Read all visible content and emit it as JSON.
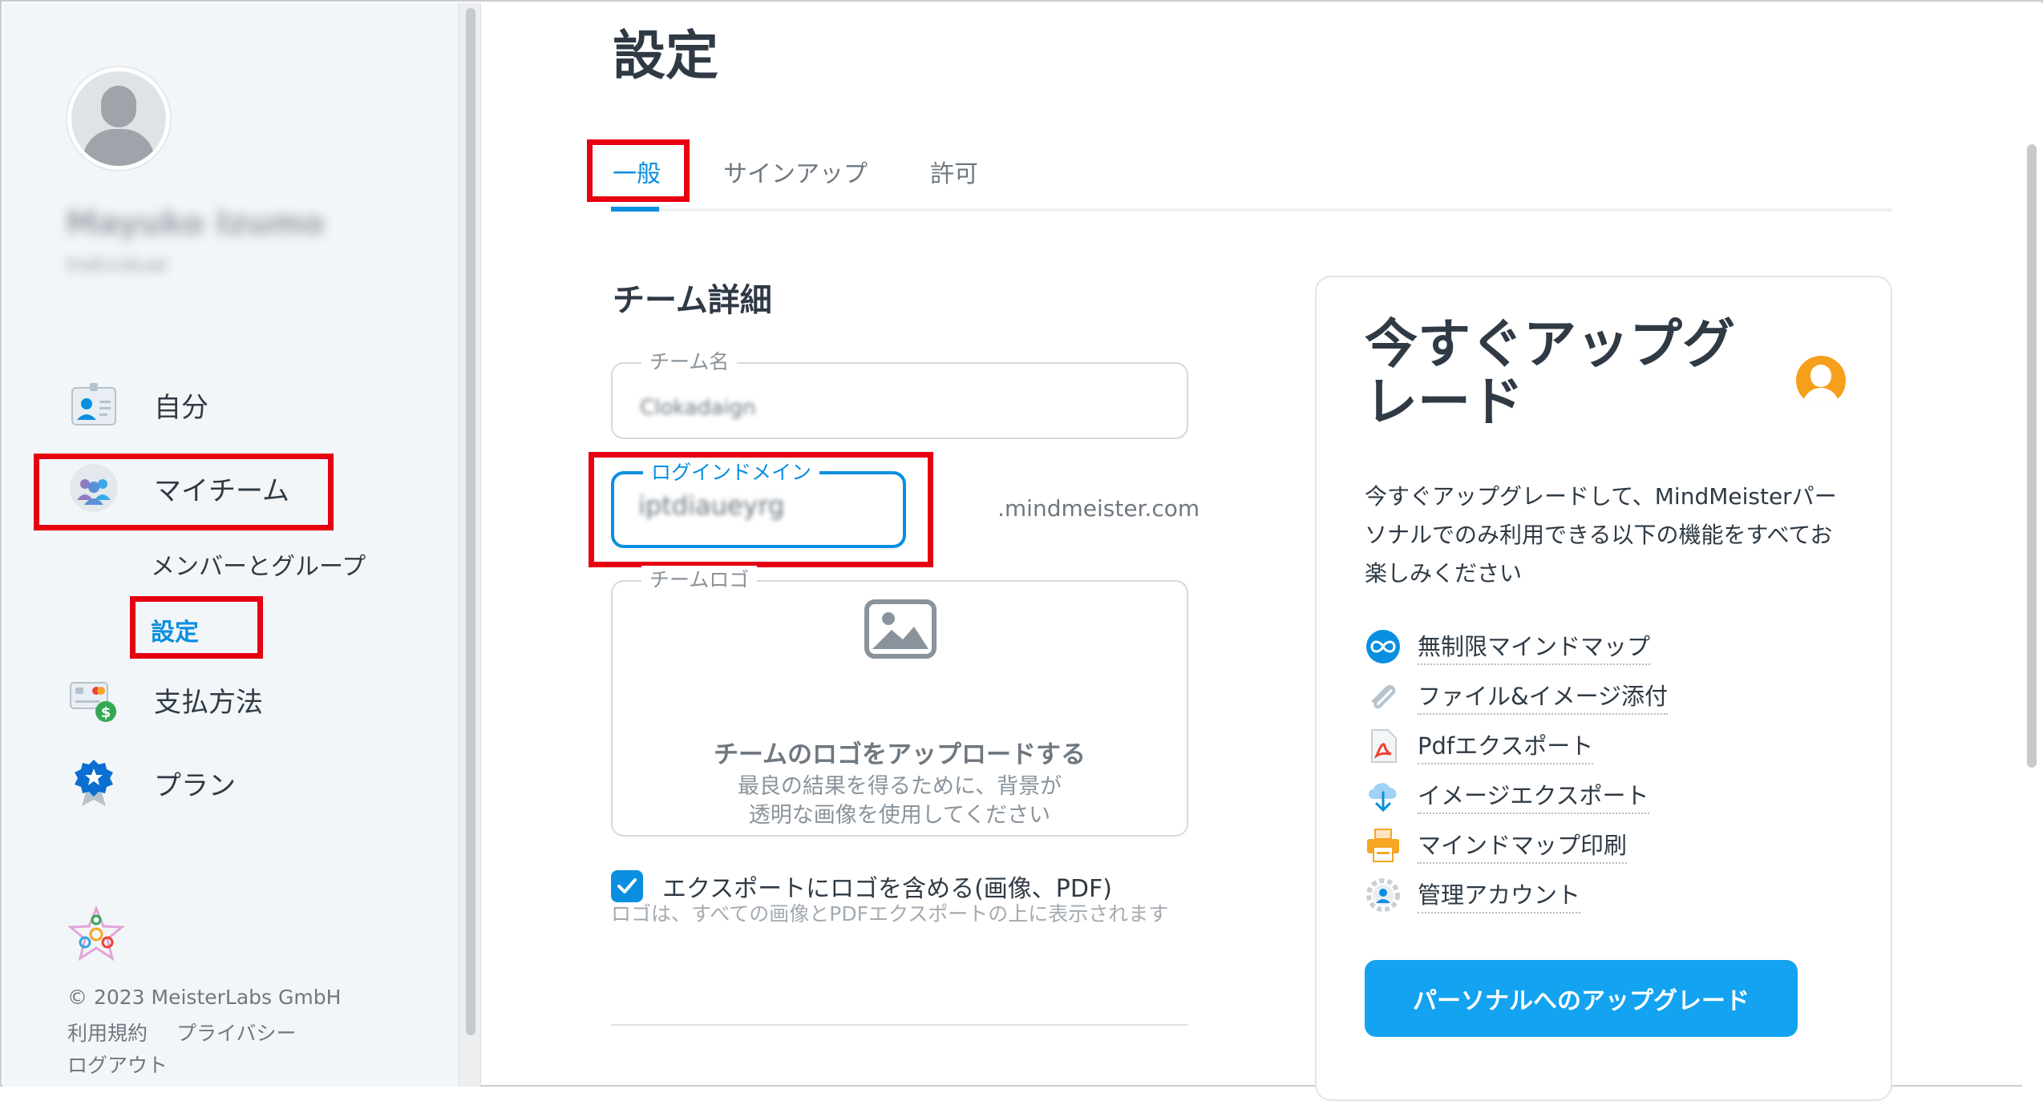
{
  "page": {
    "title": "設定"
  },
  "user": {
    "name": "Mayuko Izumo",
    "subtitle": "Individual"
  },
  "sidebar": {
    "items": [
      {
        "label": "自分",
        "icon": "id-card-icon"
      },
      {
        "label": "マイチーム",
        "icon": "team-icon"
      },
      {
        "label": "支払方法",
        "icon": "payment-icon"
      },
      {
        "label": "プラン",
        "icon": "plan-badge-icon"
      }
    ],
    "subitems": [
      {
        "label": "メンバーとグループ"
      },
      {
        "label": "設定"
      }
    ]
  },
  "footer": {
    "copyright": "© 2023 MeisterLabs GmbH",
    "terms": "利用規約",
    "privacy": "プライバシー",
    "logout": "ログアウト"
  },
  "tabs": [
    {
      "label": "一般",
      "active": true
    },
    {
      "label": "サインアップ",
      "active": false
    },
    {
      "label": "許可",
      "active": false
    }
  ],
  "team": {
    "section_title": "チーム詳細",
    "name_label": "チーム名",
    "name_value": "Clokadaign",
    "domain_label": "ログインドメイン",
    "domain_value": "iptdiaueyrg",
    "domain_suffix": ".mindmeister.com",
    "logo_label": "チームロゴ",
    "logo_upload_title": "チームのロゴをアップロードする",
    "logo_upload_desc_1": "最良の結果を得るために、背景が",
    "logo_upload_desc_2": "透明な画像を使用してください",
    "export_checkbox_label": "エクスポートにロゴを含める(画像、PDF)",
    "export_checkbox_checked": true,
    "export_help": "ロゴは、すべての画像とPDFエクスポートの上に表示されます"
  },
  "upgrade": {
    "title": "今すぐアップグレード",
    "description": "今すぐアップグレードして、MindMeisterパーソナルでのみ利用できる以下の機能をすべてお楽しみください",
    "features": [
      {
        "label": "無制限マインドマップ",
        "icon": "infinity-icon"
      },
      {
        "label": "ファイル&イメージ添付",
        "icon": "paperclip-icon"
      },
      {
        "label": "Pdfエクスポート",
        "icon": "pdf-icon"
      },
      {
        "label": "イメージエクスポート",
        "icon": "cloud-download-icon"
      },
      {
        "label": "マインドマップ印刷",
        "icon": "printer-icon"
      },
      {
        "label": "管理アカウント",
        "icon": "admin-gear-icon"
      }
    ],
    "button_label": "パーソナルへのアップグレード"
  },
  "colors": {
    "accent": "#0a8fe0",
    "highlight": "#e60012",
    "button": "#13a3f0"
  }
}
